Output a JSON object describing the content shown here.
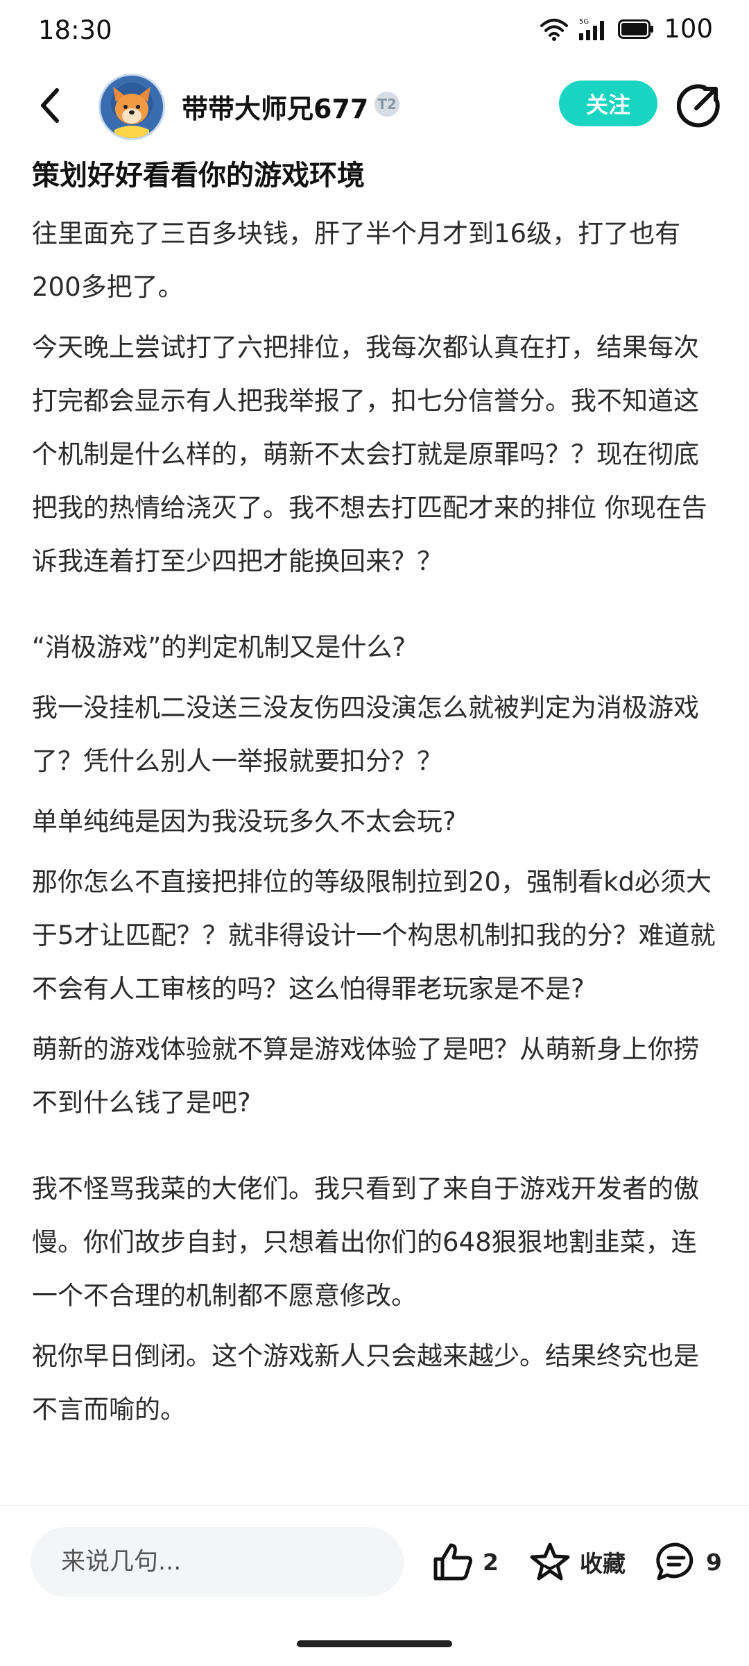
{
  "status_bar": {
    "time": "18:30",
    "battery": "100",
    "network": "5G"
  },
  "header": {
    "username": "带带大师兄677",
    "level_badge": "T2",
    "follow_label": "关注"
  },
  "post": {
    "title": "策划好好看看你的游戏环境",
    "paragraphs": [
      "往里面充了三百多块钱，肝了半个月才到16级，打了也有200多把了。",
      "今天晚上尝试打了六把排位，我每次都认真在打，结果每次打完都会显示有人把我举报了，扣七分信誉分。我不知道这个机制是什么样的，萌新不太会打就是原罪吗？？现在彻底把我的热情给浇灭了。我不想去打匹配才来的排位 你现在告诉我连着打至少四把才能换回来？？",
      "“消极游戏”的判定机制又是什么?",
      "我一没挂机二没送三没友伤四没演怎么就被判定为消极游戏了？凭什么别人一举报就要扣分？？",
      "单单纯纯是因为我没玩多久不太会玩?",
      "那你怎么不直接把排位的等级限制拉到20，强制看kd必须大于5才让匹配？？就非得设计一个构思机制扣我的分？难道就不会有人工审核的吗？这么怕得罪老玩家是不是?",
      "萌新的游戏体验就不算是游戏体验了是吧？从萌新身上你捞不到什么钱了是吧?",
      "我不怪骂我菜的大佬们。我只看到了来自于游戏开发者的傲慢。你们故步自封，只想着出你们的648狠狠地割韭菜，连一个不合理的机制都不愿意修改。",
      "祝你早日倒闭。这个游戏新人只会越来越少。结果终究也是不言而喻的。"
    ]
  },
  "bottom_bar": {
    "comment_placeholder": "来说几句...",
    "like_count": "2",
    "favorite_label": "收藏",
    "comment_count": "9"
  },
  "colors": {
    "accent": "#19d4c1",
    "input_bg": "#f4f5f7",
    "text": "#2b2b2b"
  },
  "icons": [
    "wifi-icon",
    "signal-icon",
    "battery-icon",
    "back-icon",
    "share-icon",
    "thumbs-up-icon",
    "star-icon",
    "comment-icon"
  ]
}
